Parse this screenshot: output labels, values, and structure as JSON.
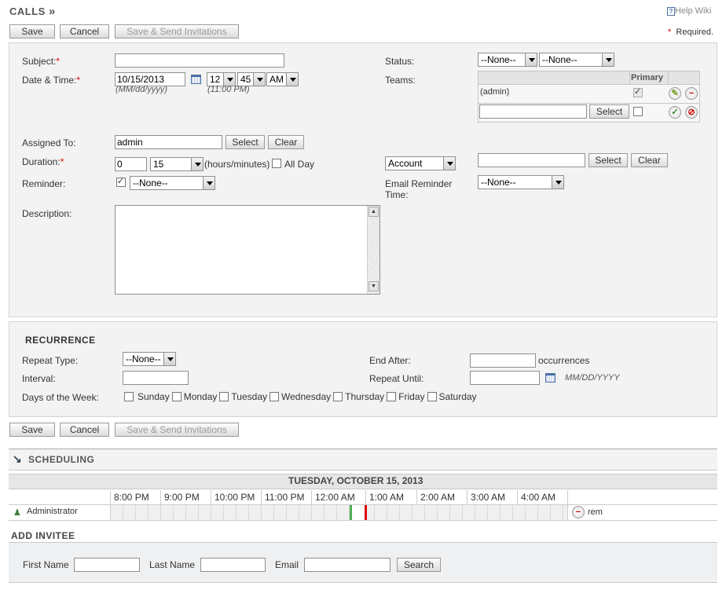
{
  "page": {
    "title": "CALLS",
    "help_link": "Help Wiki",
    "required_note": "Required."
  },
  "toolbar": {
    "save": "Save",
    "cancel": "Cancel",
    "save_send": "Save & Send Invitations"
  },
  "form": {
    "subject_label": "Subject:",
    "subject_value": "",
    "date_time_label": "Date & Time:",
    "date_value": "10/15/2013",
    "date_hint": "(MM/dd/yyyy)",
    "hour_value": "12",
    "minute_value": "45",
    "ampm_value": "AM",
    "time_hint": "(11:00 PM)",
    "status_label": "Status:",
    "status_direction": "--None--",
    "status_value": "--None--",
    "teams_label": "Teams:",
    "teams_primary_header": "Primary",
    "teams_row_name": "(admin)",
    "teams_select": "Select",
    "assigned_label": "Assigned To:",
    "assigned_value": "admin",
    "assigned_select": "Select",
    "assigned_clear": "Clear",
    "duration_label": "Duration:",
    "duration_hours": "0",
    "duration_minutes": "15",
    "duration_unit": "(hours/minutes)",
    "all_day": "All Day",
    "parent_type": "Account",
    "parent_value": "",
    "parent_select": "Select",
    "parent_clear": "Clear",
    "reminder_label": "Reminder:",
    "reminder_value": "--None--",
    "email_reminder_label_1": "Email Reminder",
    "email_reminder_label_2": "Time:",
    "email_reminder_value": "--None--",
    "description_label": "Description:",
    "description_value": ""
  },
  "recurrence": {
    "heading": "RECURRENCE",
    "repeat_type_label": "Repeat Type:",
    "repeat_type_value": "--None--",
    "interval_label": "Interval:",
    "days_label": "Days of the Week:",
    "days": [
      "Sunday",
      "Monday",
      "Tuesday",
      "Wednesday",
      "Thursday",
      "Friday",
      "Saturday"
    ],
    "end_after_label": "End After:",
    "occurrences": "occurrences",
    "repeat_until_label": "Repeat Until:",
    "repeat_until_hint": "MM/DD/YYYY"
  },
  "scheduling": {
    "heading": "SCHEDULING",
    "date_heading": "TUESDAY, OCTOBER 15, 2013",
    "hours": [
      "8:00 PM",
      "9:00 PM",
      "10:00 PM",
      "11:00 PM",
      "12:00 AM",
      "1:00 AM",
      "2:00 AM",
      "3:00 AM",
      "4:00 AM"
    ],
    "attendee": "Administrator",
    "remove_label": "rem"
  },
  "invitee": {
    "heading": "ADD INVITEE",
    "first_name_label": "First Name",
    "last_name_label": "Last Name",
    "email_label": "Email",
    "search_button": "Search"
  },
  "colors": {
    "required": "#dd0000",
    "meeting_start": "#4caf50",
    "meeting_end": "#dd0000"
  }
}
